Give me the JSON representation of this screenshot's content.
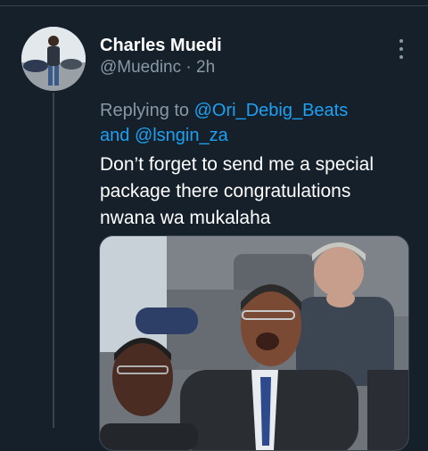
{
  "tweet": {
    "display_name": "Charles Muedi",
    "handle": "@Muedinc",
    "separator": " · ",
    "time": "2h",
    "replying_prefix": "Replying to ",
    "mention_1": "@Ori_Debig_Beats",
    "conjunction": " and ",
    "mention_2": "@lsngin_za",
    "text_line_1": "Don’t forget to send me a special",
    "text_line_2": "package there congratulations",
    "text_line_3": "nwana wa mukalaha"
  },
  "colors": {
    "background": "#15202b",
    "secondary_text": "#8899a6",
    "accent": "#1da1f2",
    "divider": "#38444d"
  },
  "icons": {
    "more": "more-vertical-icon"
  }
}
